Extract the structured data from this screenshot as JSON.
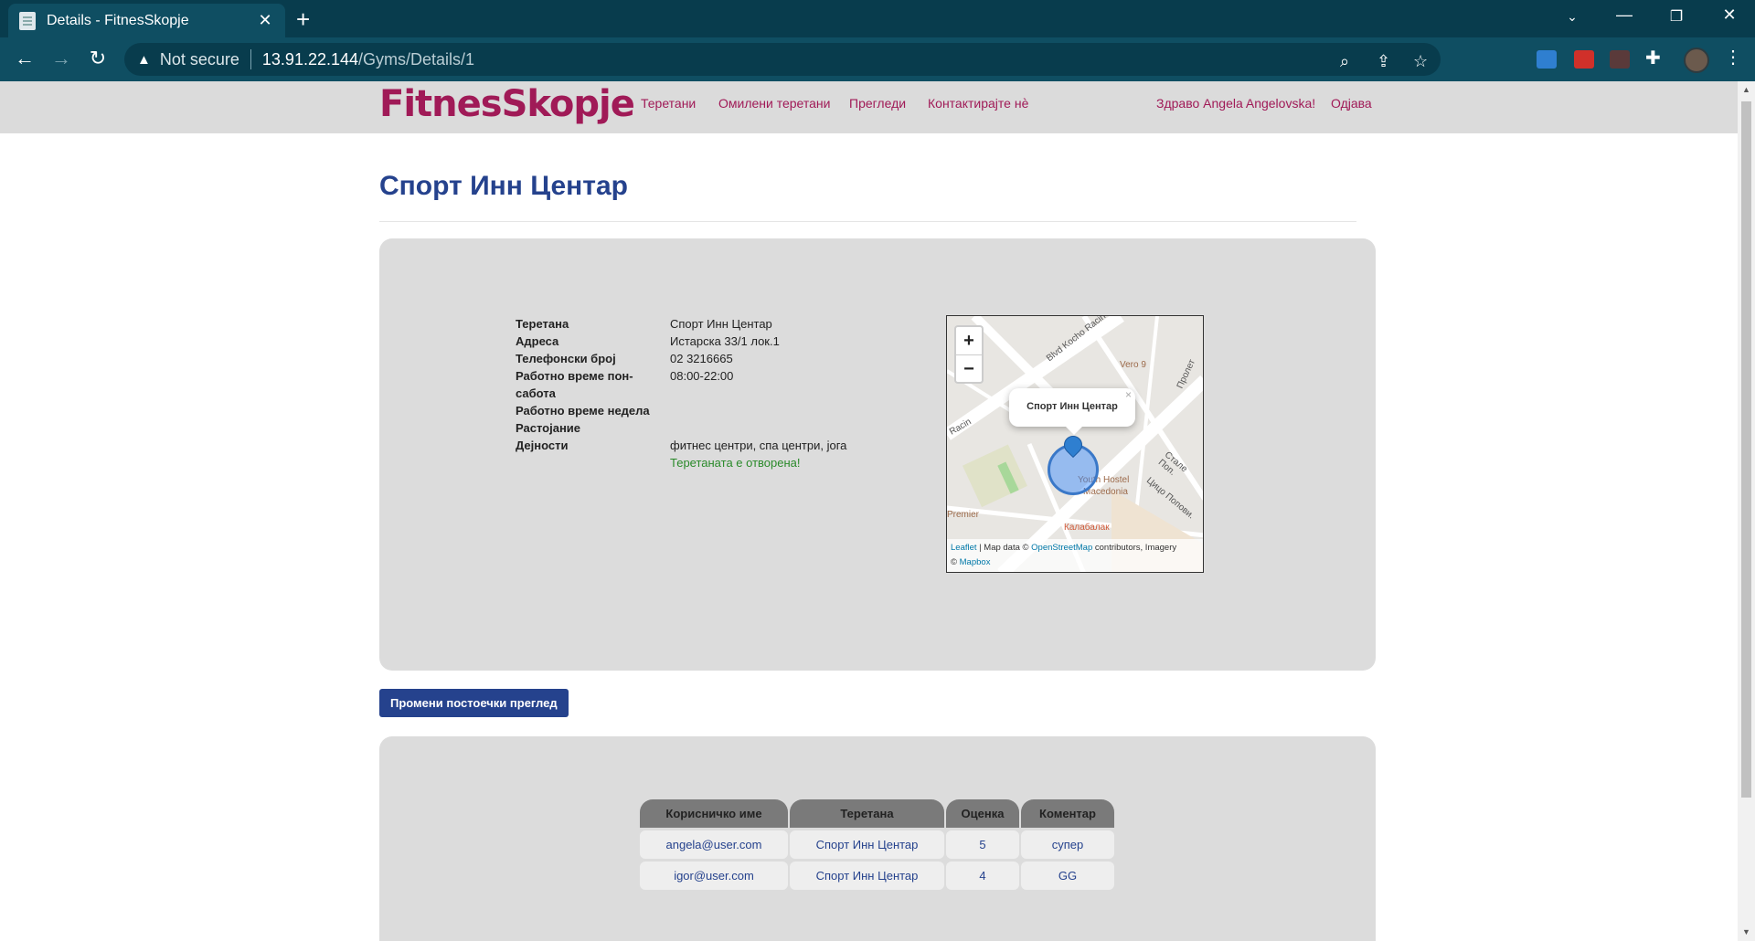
{
  "browser": {
    "tab_title": "Details - FitnesSkopje",
    "security_label": "Not secure",
    "url_host": "13.91.22.144",
    "url_path": "/Gyms/Details/1"
  },
  "site": {
    "logo": "FitnesSkopje",
    "nav": {
      "gyms": "Теретани",
      "favorites": "Омилени теретани",
      "reviews": "Прегледи",
      "contact": "Контактирајте нѐ",
      "greeting": "Здраво Angela Angelovska!",
      "logout": "Одјава"
    }
  },
  "gym": {
    "title": "Спорт Инн Центар",
    "fields": [
      {
        "label": "Теретана",
        "value": "Спорт Инн Центар"
      },
      {
        "label": "Адреса",
        "value": "Истарска 33/1 лок.1"
      },
      {
        "label": "Телефонски број",
        "value": "02 3216665"
      },
      {
        "label": "Работно време пон-сабота",
        "value": "08:00-22:00"
      },
      {
        "label": "Работно време недела",
        "value": ""
      },
      {
        "label": "Растојание",
        "value": ""
      },
      {
        "label": "Дејности",
        "value": "фитнес центри, спа центри, јога"
      }
    ],
    "status": "Теретаната е отворена!"
  },
  "map": {
    "zoom_in": "+",
    "zoom_out": "−",
    "popup_label": "Спорт Инн Центар",
    "popup_close": "×",
    "labels": {
      "blvd": "Blvd Kocho Racin",
      "racin": "Racin",
      "vero": "Vero 9",
      "prolet": "Пролет",
      "youth_hostel": "Youth Hostel",
      "macedonia": "Macedonia",
      "stale": "Стале Поп.",
      "cico": "Цицо Попови.",
      "premier": "Premier",
      "kalabalak": "Калабалак"
    },
    "attribution": {
      "leaflet": "Leaflet",
      "text1": " | Map data © ",
      "osm": "OpenStreetMap",
      "text2": " contributors, Imagery",
      "text3": "© ",
      "mapbox": "Mapbox"
    }
  },
  "change_button": "Промени постоечки преглед",
  "reviews": {
    "headers": [
      "Корисничко име",
      "Теретана",
      "Оценка",
      "Коментар"
    ],
    "rows": [
      [
        "angela@user.com",
        "Спорт Инн Центар",
        "5",
        "супер"
      ],
      [
        "igor@user.com",
        "Спорт Инн Центар",
        "4",
        "GG"
      ]
    ]
  }
}
